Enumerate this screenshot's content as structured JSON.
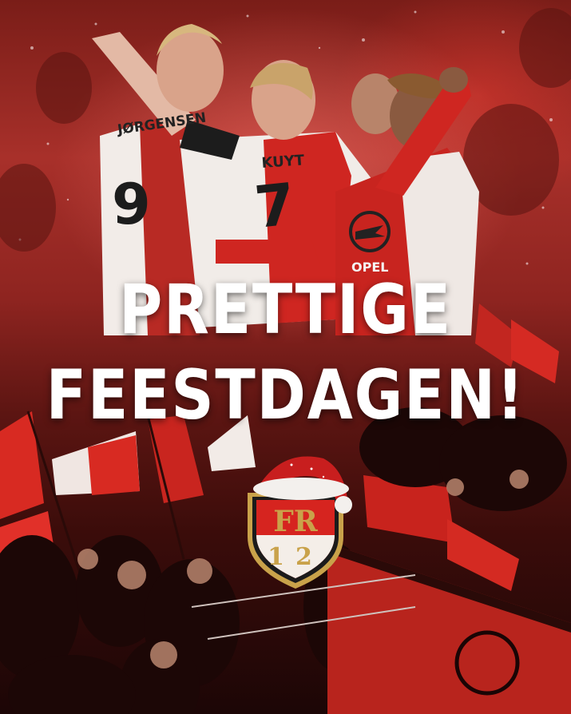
{
  "greeting": {
    "line1": "PRETTIGE",
    "line2": "FEESTDAGEN!"
  },
  "jerseys": {
    "left_name": "JØRGENSEN",
    "left_number": "9",
    "center_name": "KUYT",
    "center_number": "7",
    "sponsor": "OPEL"
  },
  "crest": {
    "letters_top": "FR",
    "number": "12"
  },
  "colors": {
    "club_red": "#d6241f",
    "crest_gold": "#c9a24a",
    "santa_hat_red": "#c81e1e"
  }
}
